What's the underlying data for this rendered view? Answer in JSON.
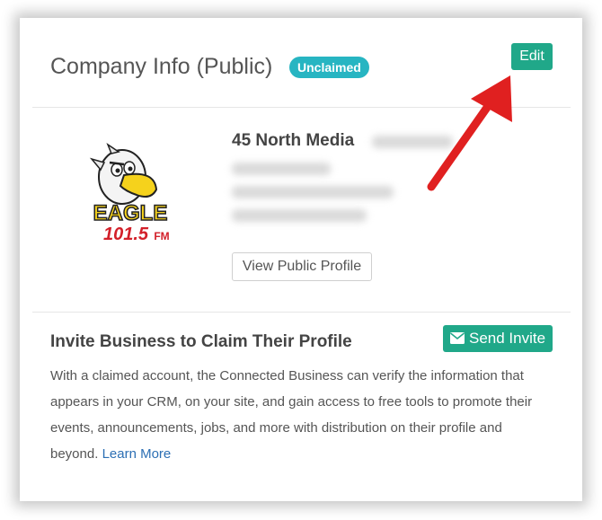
{
  "header": {
    "title": "Company Info (Public)",
    "badge": "Unclaimed",
    "edit_label": "Edit"
  },
  "company": {
    "name": "45 North Media",
    "logo": {
      "text_main": "EAGLE",
      "text_freq": "101.5",
      "text_fm": "FM",
      "icon": "eagle-mascot-logo"
    },
    "view_profile_label": "View Public Profile"
  },
  "invite": {
    "title": "Invite Business to Claim Their Profile",
    "send_label": "Send Invite",
    "send_icon": "envelope-icon",
    "description": "With a claimed account, the Connected Business can verify the information that appears in your CRM, on your site, and gain access to free tools to promote their events, announcements, jobs, and more with distribution on their profile and beyond.",
    "learn_more": "Learn More"
  },
  "colors": {
    "accent_green": "#20a889",
    "badge_teal": "#27b5c2",
    "link_blue": "#2c6fb4",
    "annotation_red": "#e02020"
  },
  "annotation": {
    "icon": "red-arrow-pointing-to-edit"
  }
}
